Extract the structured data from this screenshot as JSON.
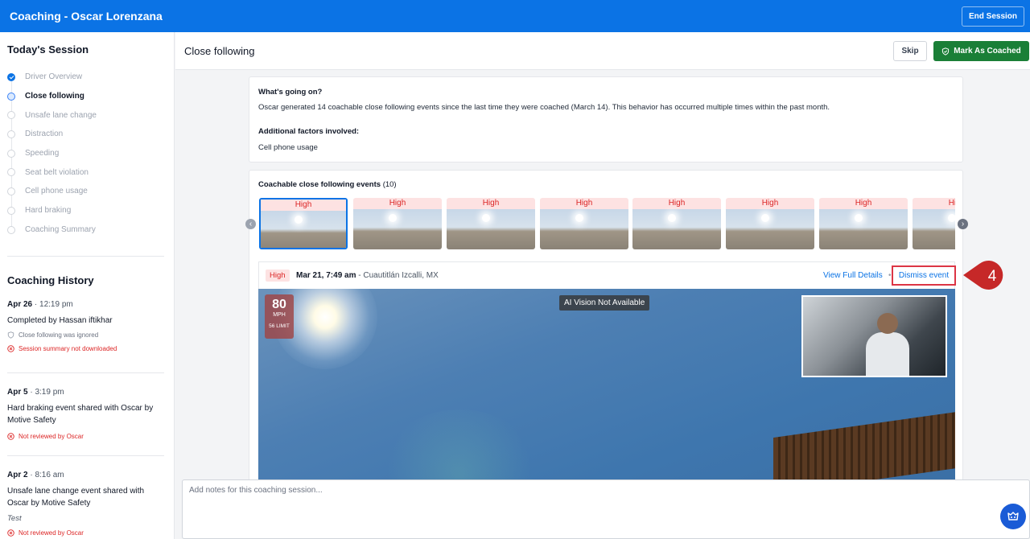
{
  "topbar": {
    "title": "Coaching - Oscar Lorenzana",
    "end_session": "End Session"
  },
  "sidebar": {
    "session_title": "Today's Session",
    "steps": [
      {
        "label": "Driver Overview",
        "state": "done"
      },
      {
        "label": "Close following",
        "state": "active"
      },
      {
        "label": "Unsafe lane change",
        "state": "pending"
      },
      {
        "label": "Distraction",
        "state": "pending"
      },
      {
        "label": "Speeding",
        "state": "pending"
      },
      {
        "label": "Seat belt violation",
        "state": "pending"
      },
      {
        "label": "Cell phone usage",
        "state": "pending"
      },
      {
        "label": "Hard braking",
        "state": "pending"
      },
      {
        "label": "Coaching Summary",
        "state": "pending"
      }
    ],
    "history_title": "Coaching History",
    "history": [
      {
        "date": "Apr 26",
        "time": "12:19 pm",
        "text": "Completed by Hassan iftikhar",
        "note": "Close following was ignored",
        "error": "Session summary not downloaded"
      },
      {
        "date": "Apr 5",
        "time": "3:19 pm",
        "text": "Hard braking event shared with Oscar by Motive Safety",
        "error": "Not reviewed by Oscar"
      },
      {
        "date": "Apr 2",
        "time": "8:16 am",
        "text": "Unsafe lane change event shared with Oscar by Motive Safety",
        "comment": "Test",
        "error": "Not reviewed by Oscar"
      }
    ]
  },
  "header": {
    "title": "Close following",
    "skip": "Skip",
    "mark_coached": "Mark As Coached"
  },
  "summary": {
    "q1": "What's going on?",
    "a1": "Oscar generated 14 coachable close following events since the last time they were coached (March 14). This behavior has occurred multiple times within the past month.",
    "q2": "Additional factors involved:",
    "a2": "Cell phone usage"
  },
  "events": {
    "title": "Coachable close following events",
    "count": "(10)",
    "thumb_labels": [
      "High",
      "High",
      "High",
      "High",
      "High",
      "High",
      "High",
      "High"
    ],
    "selected": {
      "severity": "High",
      "datetime": "Mar 21, 7:49 am",
      "location": " - Cuautitlán Izcalli, MX",
      "view_details": "View Full Details",
      "separator": "•",
      "dismiss": "Dismiss event"
    },
    "video": {
      "speed": "80",
      "speed_unit": "MPH",
      "speed_limit": "56 LIMIT",
      "ai_status": "AI Vision Not Available"
    }
  },
  "annotation": {
    "number": "4",
    "color": "#c62828"
  },
  "notes": {
    "placeholder": "Add notes for this coaching session..."
  },
  "colors": {
    "primary": "#0b73e5",
    "success": "#1a7f37",
    "danger": "#dc2626"
  }
}
